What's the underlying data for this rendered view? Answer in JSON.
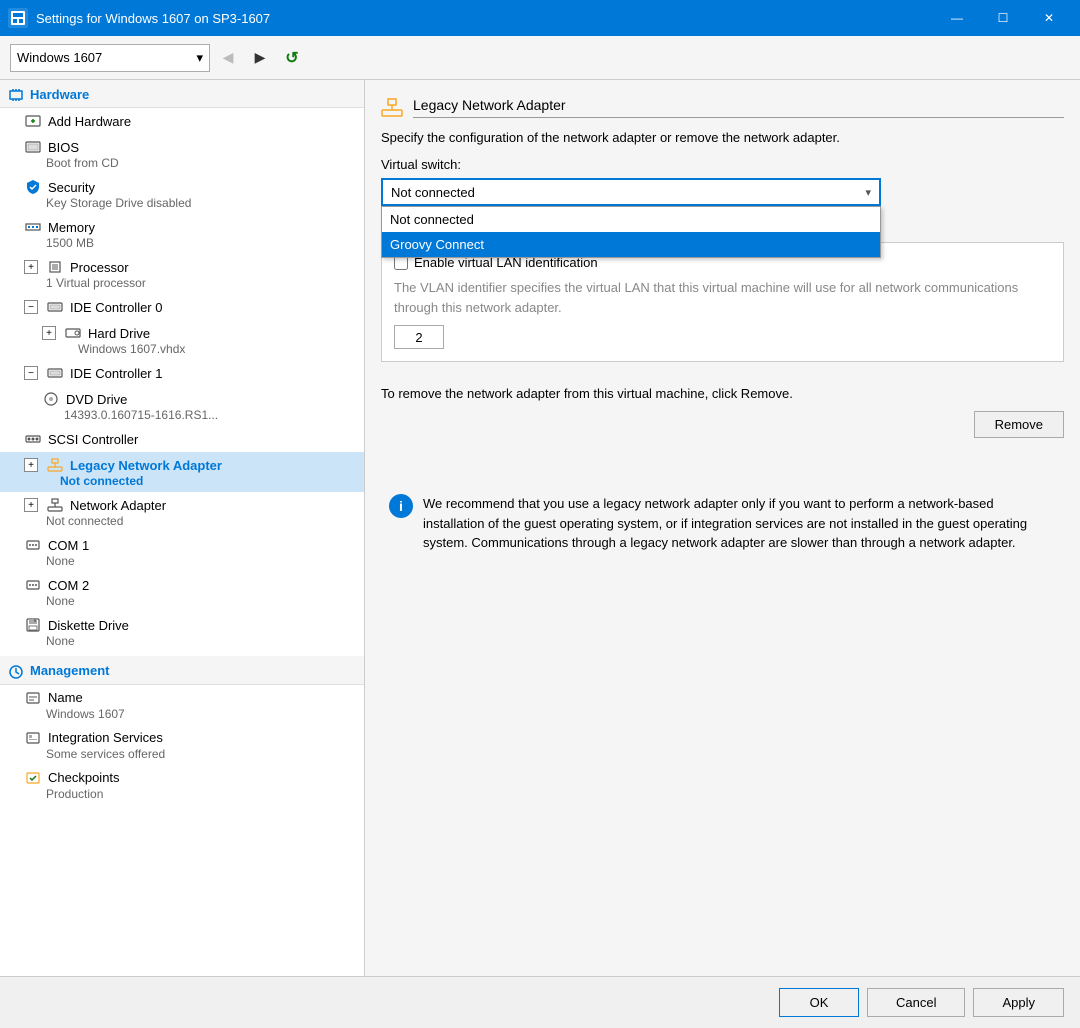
{
  "titleBar": {
    "title": "Settings for Windows 1607 on SP3-1607",
    "icon": "⚙",
    "buttons": {
      "minimize": "—",
      "maximize": "☐",
      "close": "✕"
    }
  },
  "toolbar": {
    "vmDropdown": {
      "value": "Windows 1607",
      "options": [
        "Windows 1607"
      ]
    },
    "backBtn": "◀",
    "forwardBtn": "▶",
    "refreshBtn": "↺"
  },
  "sidebar": {
    "hardware": {
      "sectionLabel": "Hardware",
      "items": [
        {
          "id": "add-hardware",
          "label": "Add Hardware",
          "sub": "",
          "indent": 1
        },
        {
          "id": "bios",
          "label": "BIOS",
          "sub": "Boot from CD",
          "indent": 1
        },
        {
          "id": "security",
          "label": "Security",
          "sub": "Key Storage Drive disabled",
          "indent": 1
        },
        {
          "id": "memory",
          "label": "Memory",
          "sub": "1500 MB",
          "indent": 1
        },
        {
          "id": "processor",
          "label": "Processor",
          "sub": "1 Virtual processor",
          "indent": 1,
          "expand": true
        },
        {
          "id": "ide-controller-0",
          "label": "IDE Controller 0",
          "sub": "",
          "indent": 1,
          "collapse": true
        },
        {
          "id": "hard-drive",
          "label": "Hard Drive",
          "sub": "Windows 1607.vhdx",
          "indent": 2,
          "expand": true
        },
        {
          "id": "ide-controller-1",
          "label": "IDE Controller 1",
          "sub": "",
          "indent": 1,
          "collapse": true
        },
        {
          "id": "dvd-drive",
          "label": "DVD Drive",
          "sub": "14393.0.160715-1616.RS1...",
          "indent": 2
        },
        {
          "id": "scsi-controller",
          "label": "SCSI Controller",
          "sub": "",
          "indent": 1
        },
        {
          "id": "legacy-network-adapter",
          "label": "Legacy Network Adapter",
          "sub": "Not connected",
          "indent": 1,
          "expand": true,
          "selected": true,
          "blue": true
        },
        {
          "id": "network-adapter",
          "label": "Network Adapter",
          "sub": "Not connected",
          "indent": 1,
          "expand": true
        },
        {
          "id": "com1",
          "label": "COM 1",
          "sub": "None",
          "indent": 1
        },
        {
          "id": "com2",
          "label": "COM 2",
          "sub": "None",
          "indent": 1
        },
        {
          "id": "diskette-drive",
          "label": "Diskette Drive",
          "sub": "None",
          "indent": 1
        }
      ]
    },
    "management": {
      "sectionLabel": "Management",
      "items": [
        {
          "id": "name",
          "label": "Name",
          "sub": "Windows 1607",
          "indent": 1
        },
        {
          "id": "integration-services",
          "label": "Integration Services",
          "sub": "Some services offered",
          "indent": 1
        },
        {
          "id": "checkpoints",
          "label": "Checkpoints",
          "sub": "Production",
          "indent": 1
        }
      ]
    }
  },
  "mainPanel": {
    "title": "Legacy Network Adapter",
    "description": "Specify the configuration of the network adapter or remove the network adapter.",
    "virtualSwitchLabel": "Virtual switch:",
    "dropdown": {
      "selected": "Not connected",
      "options": [
        "Not connected",
        "Groovy Connect"
      ],
      "highlighted": "Groovy Connect"
    },
    "checkbox": {
      "label": "Enable virtual LAN identification",
      "checked": false
    },
    "vlanDesc": "The VLAN identifier specifies the virtual LAN that this virtual machine will use for all network communications through this network adapter.",
    "vlanValue": "2",
    "removeDesc": "To remove the network adapter from this virtual machine, click Remove.",
    "removeBtn": "Remove",
    "infoText": "We recommend that you use a legacy network adapter only if you want to perform a network-based installation of the guest operating system, or if integration services are not installed in the guest operating system. Communications through a legacy network adapter are slower than through a network adapter."
  },
  "bottomBar": {
    "okLabel": "OK",
    "cancelLabel": "Cancel",
    "applyLabel": "Apply"
  }
}
